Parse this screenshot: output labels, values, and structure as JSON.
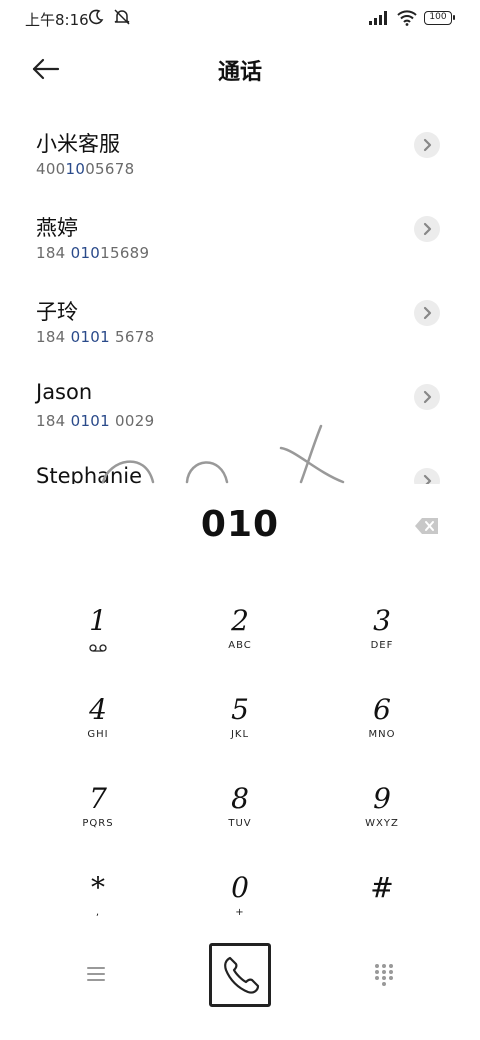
{
  "status_bar": {
    "time": "上午8:16",
    "battery": "100",
    "icons": [
      "moon-icon",
      "mute-icon",
      "signal-icon",
      "wifi-icon",
      "battery-icon"
    ]
  },
  "header": {
    "title": "通话",
    "back_icon": "arrow-left-icon"
  },
  "contacts": [
    {
      "name": "小米客服",
      "number_parts": [
        "400",
        "1",
        "0",
        "05678"
      ]
    },
    {
      "name": "燕婷",
      "number_parts": [
        "184 ",
        "010",
        "15689"
      ]
    },
    {
      "name": "子玲",
      "number_parts": [
        "184 ",
        "0101",
        " 5678"
      ]
    },
    {
      "name": "Jason",
      "number_parts": [
        "184 ",
        "0101",
        " 0029"
      ]
    },
    {
      "name": "Stephanie",
      "number_parts": [
        "",
        "",
        ""
      ]
    }
  ],
  "dial": {
    "input": "010"
  },
  "keypad": [
    {
      "digit": "1",
      "letters": ""
    },
    {
      "digit": "2",
      "letters": "ABC"
    },
    {
      "digit": "3",
      "letters": "DEF"
    },
    {
      "digit": "4",
      "letters": "GHI"
    },
    {
      "digit": "5",
      "letters": "JKL"
    },
    {
      "digit": "6",
      "letters": "MNO"
    },
    {
      "digit": "7",
      "letters": "PQRS"
    },
    {
      "digit": "8",
      "letters": "TUV"
    },
    {
      "digit": "9",
      "letters": "WXYZ"
    },
    {
      "digit": "*",
      "letters": ","
    },
    {
      "digit": "0",
      "letters": "+"
    },
    {
      "digit": "#",
      "letters": ""
    }
  ]
}
